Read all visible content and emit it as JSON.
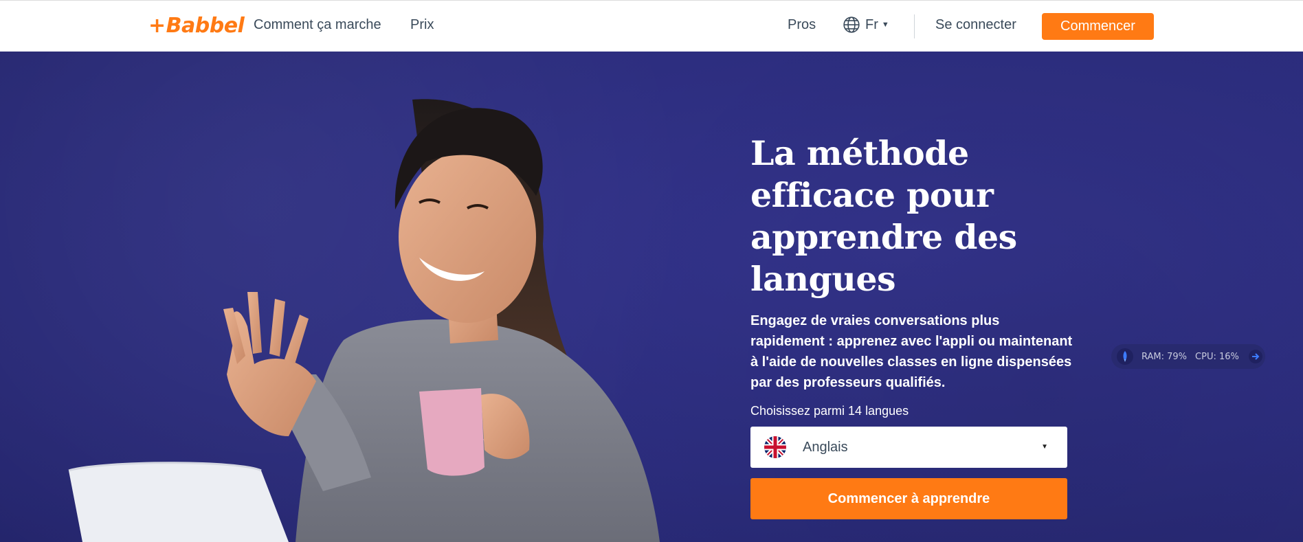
{
  "header": {
    "logo_text": "Babbel",
    "nav": {
      "how_it_works": "Comment ça marche",
      "pricing": "Prix",
      "pros": "Pros",
      "language": "Fr",
      "login": "Se connecter",
      "start": "Commencer"
    }
  },
  "hero": {
    "headline": "La méthode efficace pour apprendre des langues",
    "subtext": "Engagez de vraies conversations plus rapidement : apprenez avec l'appli ou maintenant à l'aide de nouvelles classes en ligne dispensées par des professeurs qualifiés.",
    "choose_label": "Choisissez parmi 14 langues",
    "selected_language": "Anglais",
    "cta": "Commencer à apprendre"
  },
  "overlay": {
    "ram": "RAM: 79%",
    "cpu": "CPU: 16%"
  },
  "colors": {
    "brand_orange": "#ff7a14",
    "hero_blue": "#2c2d7e"
  }
}
